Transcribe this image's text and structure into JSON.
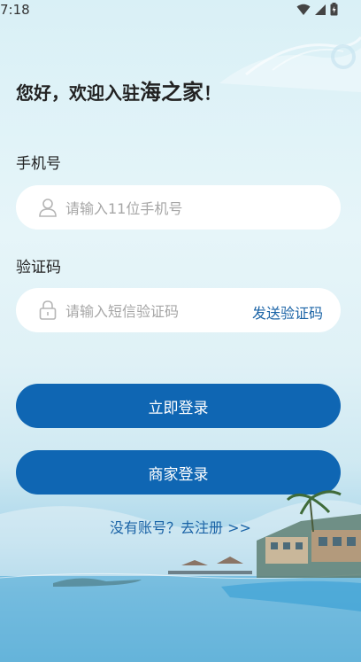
{
  "status_bar": {
    "time": "7:18"
  },
  "welcome": {
    "text": "您好，欢迎入驻",
    "brand": "海之家",
    "suffix": "！"
  },
  "phone": {
    "label": "手机号",
    "placeholder": "请输入11位手机号"
  },
  "code": {
    "label": "验证码",
    "placeholder": "请输入短信验证码",
    "send_button": "发送验证码"
  },
  "buttons": {
    "login": "立即登录",
    "merchant_login": "商家登录"
  },
  "register_link": "没有账号？去注册 >>",
  "colors": {
    "primary": "#0f66b3",
    "link": "#1a63a6",
    "placeholder": "#a6a6a6"
  },
  "icons": {
    "phone_field": "user-icon",
    "code_field": "lock-icon"
  }
}
